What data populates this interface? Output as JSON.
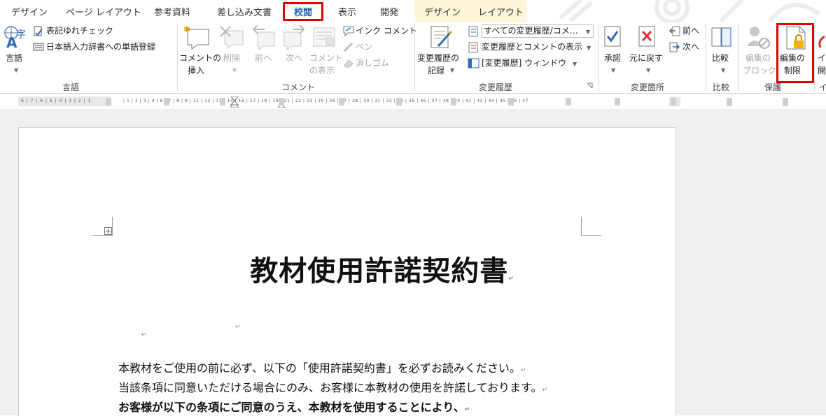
{
  "tabs": [
    {
      "label": "デザイン"
    },
    {
      "label": "ページ レイアウト"
    },
    {
      "label": "参考資料"
    },
    {
      "label": "差し込み文書"
    },
    {
      "label": "校閲"
    },
    {
      "label": "表示"
    },
    {
      "label": "開発"
    },
    {
      "label": "デザイン"
    },
    {
      "label": "レイアウト"
    }
  ],
  "ribbon": {
    "language": {
      "lang_button": "言語",
      "spelling": "表記ゆれチェック",
      "dictionary": "日本語入力辞書への単語登録",
      "group": "言語"
    },
    "comments": {
      "insert_line1": "コメントの",
      "insert_line2": "挿入",
      "delete": "削除",
      "prev": "前へ",
      "next": "次へ",
      "show_line1": "コメント",
      "show_line2": "の表示",
      "ink_comment": "インク コメント",
      "pen": "ペン",
      "eraser": "消しゴム",
      "group": "コメント"
    },
    "tracking": {
      "track_line1": "変更履歴の",
      "track_line2": "記録",
      "markup_select": "すべての変更履歴/コメ…",
      "show_markup": "変更履歴とコメントの表示",
      "pane": "[変更履歴] ウィンドウ",
      "group": "変更履歴"
    },
    "changes": {
      "accept": "承諾",
      "reject": "元に戻す",
      "prev": "前へ",
      "next": "次へ",
      "group": "変更箇所"
    },
    "compare": {
      "compare": "比較",
      "group": "比較"
    },
    "protect": {
      "block_line1": "編集の",
      "block_line2": "ブロック",
      "restrict_line1": "編集の",
      "restrict_line2": "制限",
      "group": "保護"
    },
    "ink": {
      "line1": "イン",
      "line2": "開",
      "group": "イ"
    }
  },
  "ruler": {
    "left_numbers": "6 | 7 | 6 | 5 | 4 | 3 | 2 | 1",
    "main_numbers": "| 1 | 2 | 3 | 4 | 6 | 7 | 8 | 9 | 11 | 12 | 13 | 14 | 16 | 17 | 18 | 19 | 21 | 22 | 23 | 25 | 26 | 27 | 28 | 30 | 31 | 32 | 33 | 35 | 36 | 37 | 38 | 40 | 41 | 42 | 44 | 45 | 46 | 47"
  },
  "document": {
    "title": "教材使用許諾契約書",
    "paragraphs": [
      "本教材をご使用の前に必ず、以下の「使用許諾契約書」を必ずお読みください。",
      "当該条項に同意いただける場合にのみ、お客様に本教材の使用を許諾しております。",
      "お客様が以下の条項にご同意のうえ、本教材を使用することにより、"
    ],
    "paragraph_mark": "↵"
  },
  "colors": {
    "highlight": "#e00000",
    "active_tab": "#1f5fae",
    "contextual_band": "#fdf6d8"
  }
}
